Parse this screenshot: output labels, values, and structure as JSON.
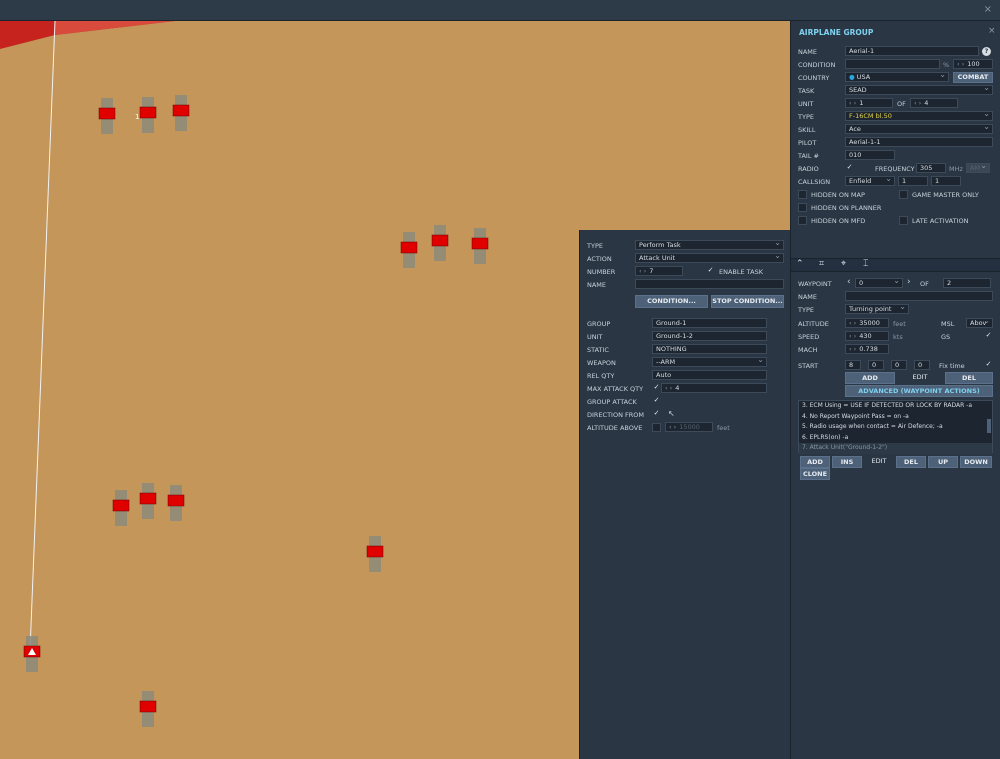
{
  "window": {
    "close": "×"
  },
  "map": {
    "units": [
      {
        "label": ""
      },
      {
        "label": ""
      },
      {
        "label": ""
      },
      {
        "label": ""
      },
      {
        "label": ""
      },
      {
        "label": ""
      },
      {
        "label": ""
      },
      {
        "label": ""
      },
      {
        "label": ""
      },
      {
        "label": ""
      },
      {
        "label": ""
      },
      {
        "label": ""
      }
    ],
    "unit_badge": "1"
  },
  "task": {
    "type_label": "TYPE",
    "type_value": "Perform Task",
    "action_label": "ACTION",
    "action_value": "Attack Unit",
    "number_label": "NUMBER",
    "number_value": "7",
    "enable_task_label": "ENABLE TASK",
    "name_label": "NAME",
    "name_value": "",
    "condition_button": "CONDITION...",
    "stop_condition_button": "STOP CONDITION...",
    "group_label": "GROUP",
    "group_value": "Ground-1",
    "unit_label": "UNIT",
    "unit_value": "Ground-1-2",
    "static_label": "STATIC",
    "static_value": "NOTHING",
    "weapon_label": "WEAPON",
    "weapon_value": "--ARM",
    "rel_qty_label": "REL QTY",
    "rel_qty_value": "Auto",
    "max_attack_label": "MAX ATTACK QTY",
    "max_attack_value": "4",
    "group_attack_label": "GROUP ATTACK",
    "direction_label": "DIRECTION FROM",
    "altitude_label": "ALTITUDE ABOVE",
    "altitude_value": "15000",
    "altitude_unit": "feet"
  },
  "group": {
    "title": "AIRPLANE GROUP",
    "help": "?",
    "name_label": "NAME",
    "name_value": "Aerial-1",
    "condition_label": "CONDITION",
    "condition_value": "",
    "condition_pct": "%",
    "condition_num": "100",
    "country_label": "COUNTRY",
    "country_value": "USA",
    "combat_button": "COMBAT",
    "task_label": "TASK",
    "task_value": "SEAD",
    "unit_label": "UNIT",
    "unit_value": "1",
    "unit_of": "OF",
    "unit_total": "4",
    "type_label": "TYPE",
    "type_value": "F-16CM bl.50",
    "skill_label": "SKILL",
    "skill_value": "Ace",
    "pilot_label": "PILOT",
    "pilot_value": "Aerial-1-1",
    "tail_label": "TAIL #",
    "tail_value": "010",
    "radio_label": "RADIO",
    "frequency_label": "FREQUENCY",
    "frequency_value": "305",
    "mhz": "MHz",
    "am": "AM",
    "callsign_label": "CALLSIGN",
    "callsign_value": "Enfield",
    "callsign_n1": "1",
    "callsign_n2": "1",
    "hidden_map": "HIDDEN ON MAP",
    "gm_only": "GAME MASTER ONLY",
    "hidden_planner": "HIDDEN ON PLANNER",
    "hidden_mfd": "HIDDEN ON MFD",
    "late_activation": "LATE ACTIVATION"
  },
  "waypoint": {
    "waypoint_label": "WAYPOINT",
    "waypoint_value": "0",
    "of_label": "OF",
    "of_value": "2",
    "name_label": "NAME",
    "name_value": "",
    "type_label": "TYPE",
    "type_value": "Turning point",
    "altitude_label": "ALTITUDE",
    "altitude_value": "35000",
    "altitude_unit": "feet",
    "msl": "MSL",
    "above": "Abov",
    "speed_label": "SPEED",
    "speed_value": "430",
    "speed_unit": "kts",
    "gs": "GS",
    "mach_label": "MACH",
    "mach_value": "0.738",
    "start_label": "START",
    "start_d": "8",
    "start_h": "0",
    "start_m": "0",
    "start_s": "0",
    "fix_time": "Fix time",
    "add_button": "ADD",
    "edit_button": "EDIT",
    "del_button": "DEL",
    "advanced_button": "ADVANCED (WAYPOINT ACTIONS)",
    "actions": [
      "3. ECM Using = USE IF DETECTED OR LOCK BY RADAR -a",
      "4. No Report Waypoint Pass = on -a",
      "5. Radio usage when contact = Air Defence; -a",
      "6. EPLRS(on)  -a",
      "7. Attack Unit(\"Ground-1-2\")"
    ],
    "list_add": "ADD",
    "list_ins": "INS",
    "list_edit": "EDIT",
    "list_del": "DEL",
    "list_up": "UP",
    "list_down": "DOWN",
    "list_clone": "CLONE"
  },
  "colors": {
    "panel": "#2a3644",
    "map": "#c4965a",
    "accent": "#7fd1f0",
    "unit_red": "#e00000"
  }
}
